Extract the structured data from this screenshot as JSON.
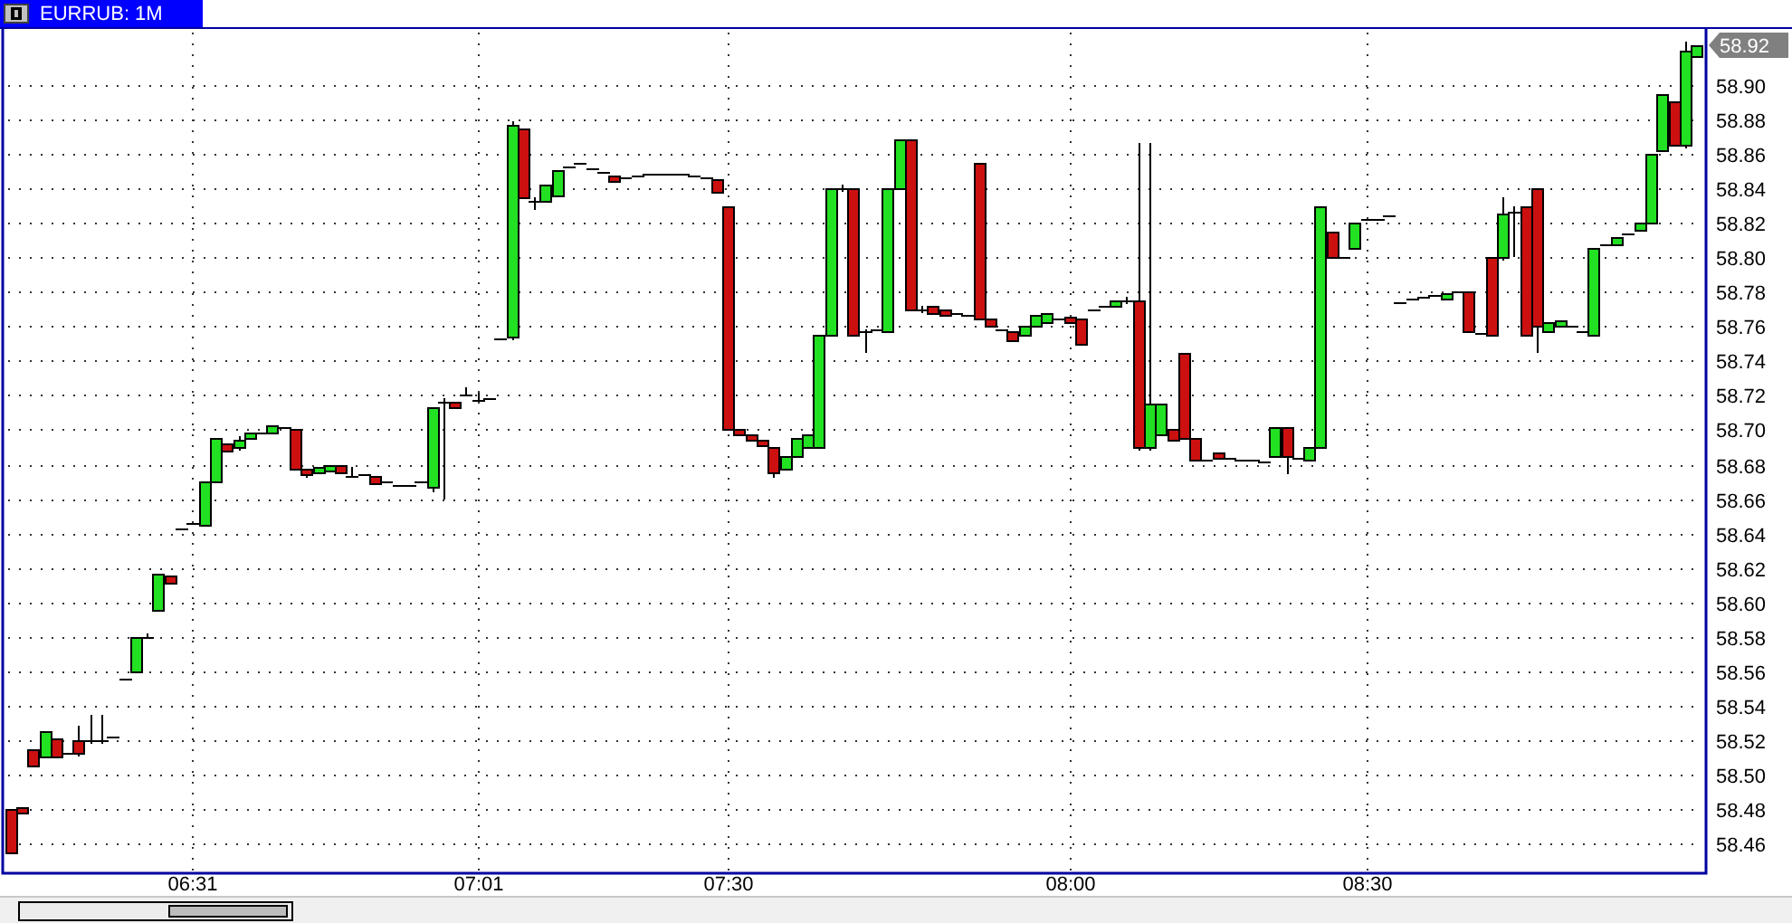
{
  "window": {
    "title": "EURRUB: 1M"
  },
  "chart_data": {
    "type": "candlestick",
    "categories": [
      null,
      null,
      null,
      null,
      null,
      null,
      null,
      null,
      null,
      null,
      null,
      null,
      null,
      null,
      null,
      null,
      "06:31",
      null,
      null,
      null,
      null,
      null,
      null,
      null,
      null,
      null,
      null,
      null,
      null,
      null,
      null,
      null,
      null,
      null,
      null,
      null,
      null,
      null,
      null,
      null,
      null,
      "07:01",
      null,
      null,
      null,
      null,
      null,
      null,
      null,
      null,
      null,
      null,
      null,
      null,
      null,
      null,
      null,
      null,
      null,
      null,
      null,
      null,
      null,
      "07:30",
      null,
      null,
      null,
      null,
      null,
      null,
      null,
      null,
      null,
      null,
      null,
      null,
      null,
      null,
      null,
      null,
      null,
      null,
      null,
      null,
      null,
      null,
      null,
      null,
      null,
      null,
      null,
      null,
      null,
      "08:00",
      null,
      null,
      null,
      null,
      null,
      null,
      null,
      null,
      null,
      null,
      null,
      null,
      null,
      null,
      null,
      null,
      null,
      null,
      null,
      null,
      null,
      null,
      null,
      null,
      null,
      "08:30",
      null,
      null,
      null,
      null,
      null,
      null,
      null,
      null,
      null,
      null,
      null,
      null,
      null,
      null,
      null,
      null,
      null,
      null,
      null,
      null,
      null,
      null,
      null,
      null,
      null,
      null,
      null,
      null,
      null
    ],
    "ohlc": [
      [
        58.48,
        58.48,
        58.455,
        58.455
      ],
      [
        58.481,
        58.481,
        58.479,
        58.479
      ],
      [
        58.515,
        58.515,
        58.505,
        58.505
      ],
      [
        58.51,
        58.525,
        58.51,
        58.525
      ],
      [
        58.521,
        58.521,
        58.511,
        58.511
      ],
      [
        58.513,
        58.513,
        58.513,
        58.513
      ],
      [
        58.52,
        58.528,
        58.511,
        58.513
      ],
      [
        58.52,
        58.535,
        58.518,
        58.52
      ],
      [
        58.52,
        58.535,
        58.518,
        58.52
      ],
      [
        58.522,
        58.522,
        58.522,
        58.522
      ],
      [
        58.556,
        58.556,
        58.556,
        58.556
      ],
      [
        58.56,
        58.58,
        58.56,
        58.58
      ],
      [
        58.58,
        58.582,
        58.579,
        58.58
      ],
      [
        58.595,
        58.617,
        58.595,
        58.617
      ],
      [
        58.615,
        58.615,
        58.611,
        58.611
      ],
      [
        58.643,
        58.643,
        58.643,
        58.643
      ],
      [
        58.646,
        58.646,
        58.646,
        58.646
      ],
      [
        58.645,
        58.67,
        58.645,
        58.67
      ],
      [
        58.67,
        58.695,
        58.67,
        58.695
      ],
      [
        58.692,
        58.692,
        58.688,
        58.688
      ],
      [
        58.69,
        58.696,
        58.688,
        58.694
      ],
      [
        58.695,
        58.698,
        58.695,
        58.698
      ],
      [
        58.698,
        58.698,
        58.698,
        58.698
      ],
      [
        58.698,
        58.703,
        58.698,
        58.703
      ],
      [
        58.702,
        58.702,
        58.702,
        58.702
      ],
      [
        58.7,
        58.7,
        58.677,
        58.677
      ],
      [
        58.677,
        58.677,
        58.672,
        58.674
      ],
      [
        58.675,
        58.678,
        58.675,
        58.678
      ],
      [
        58.677,
        58.68,
        58.677,
        58.68
      ],
      [
        58.68,
        58.68,
        58.675,
        58.675
      ],
      [
        58.673,
        58.678,
        58.672,
        58.673
      ],
      [
        58.674,
        58.674,
        58.674,
        58.674
      ],
      [
        58.673,
        58.673,
        58.669,
        58.669
      ],
      [
        58.67,
        58.67,
        58.67,
        58.67
      ],
      [
        58.668,
        58.668,
        58.668,
        58.668
      ],
      [
        58.668,
        58.668,
        58.668,
        58.668
      ],
      [
        58.67,
        58.67,
        58.67,
        58.67
      ],
      [
        58.667,
        58.713,
        58.664,
        58.713
      ],
      [
        58.716,
        58.718,
        58.66,
        58.716
      ],
      [
        58.716,
        58.716,
        58.713,
        58.713
      ],
      [
        58.72,
        58.725,
        58.719,
        58.72
      ],
      [
        58.717,
        58.721,
        58.716,
        58.717
      ],
      [
        58.718,
        58.718,
        58.718,
        58.718
      ],
      [
        58.753,
        58.753,
        58.753,
        58.753
      ],
      [
        58.754,
        58.879,
        58.752,
        58.877
      ],
      [
        58.875,
        58.875,
        58.835,
        58.835
      ],
      [
        58.833,
        58.835,
        58.828,
        58.833
      ],
      [
        58.833,
        58.842,
        58.833,
        58.842
      ],
      [
        58.836,
        58.851,
        58.836,
        58.851
      ],
      [
        58.853,
        58.853,
        58.853,
        58.853
      ],
      [
        58.855,
        58.855,
        58.855,
        58.855
      ],
      [
        58.852,
        58.852,
        58.852,
        58.852
      ],
      [
        58.85,
        58.85,
        58.85,
        58.85
      ],
      [
        58.847,
        58.847,
        58.844,
        58.844
      ],
      [
        58.846,
        58.846,
        58.846,
        58.846
      ],
      [
        58.847,
        58.847,
        58.847,
        58.847
      ],
      [
        58.848,
        58.848,
        58.848,
        58.848
      ],
      [
        58.849,
        58.849,
        58.849,
        58.849
      ],
      [
        58.849,
        58.849,
        58.849,
        58.849
      ],
      [
        58.848,
        58.848,
        58.848,
        58.848
      ],
      [
        58.847,
        58.847,
        58.847,
        58.847
      ],
      [
        58.846,
        58.846,
        58.846,
        58.846
      ],
      [
        58.845,
        58.845,
        58.838,
        58.838
      ],
      [
        58.83,
        58.83,
        58.7,
        58.7
      ],
      [
        58.7,
        58.7,
        58.697,
        58.697
      ],
      [
        58.697,
        58.697,
        58.695,
        58.695
      ],
      [
        58.694,
        58.694,
        58.691,
        58.691
      ],
      [
        58.69,
        58.69,
        58.672,
        58.675
      ],
      [
        58.677,
        58.685,
        58.677,
        58.685
      ],
      [
        58.685,
        58.695,
        58.685,
        58.695
      ],
      [
        58.69,
        58.697,
        58.69,
        58.697
      ],
      [
        58.69,
        58.755,
        58.69,
        58.755
      ],
      [
        58.755,
        58.84,
        58.755,
        58.84
      ],
      [
        58.84,
        58.842,
        58.838,
        58.84
      ],
      [
        58.84,
        58.84,
        58.755,
        58.755
      ],
      [
        58.757,
        58.758,
        58.745,
        58.757
      ],
      [
        58.758,
        58.758,
        58.758,
        58.758
      ],
      [
        58.757,
        58.84,
        58.757,
        58.84
      ],
      [
        58.84,
        58.868,
        58.84,
        58.868
      ],
      [
        58.868,
        58.868,
        58.77,
        58.77
      ],
      [
        58.77,
        58.772,
        58.768,
        58.77
      ],
      [
        58.772,
        58.772,
        58.768,
        58.768
      ],
      [
        58.77,
        58.77,
        58.767,
        58.767
      ],
      [
        58.768,
        58.768,
        58.768,
        58.768
      ],
      [
        58.767,
        58.767,
        58.767,
        58.767
      ],
      [
        58.855,
        58.855,
        58.765,
        58.765
      ],
      [
        58.765,
        58.765,
        58.76,
        58.76
      ],
      [
        58.758,
        58.758,
        58.758,
        58.758
      ],
      [
        58.757,
        58.757,
        58.752,
        58.752
      ],
      [
        58.755,
        58.76,
        58.755,
        58.76
      ],
      [
        58.76,
        58.767,
        58.76,
        58.767
      ],
      [
        58.762,
        58.768,
        58.762,
        58.768
      ],
      [
        58.765,
        58.765,
        58.765,
        58.765
      ],
      [
        58.766,
        58.766,
        58.764,
        58.764
      ],
      [
        58.765,
        58.765,
        58.75,
        58.75
      ],
      [
        58.77,
        58.77,
        58.77,
        58.77
      ],
      [
        58.772,
        58.772,
        58.772,
        58.772
      ],
      [
        58.772,
        58.775,
        58.772,
        58.775
      ],
      [
        58.775,
        58.777,
        58.773,
        58.775
      ],
      [
        58.775,
        58.866,
        58.688,
        58.69
      ],
      [
        58.69,
        58.866,
        58.688,
        58.715
      ],
      [
        58.697,
        58.715,
        58.697,
        58.715
      ],
      [
        58.7,
        58.7,
        58.694,
        58.694
      ],
      [
        58.745,
        58.745,
        58.695,
        58.695
      ],
      [
        58.695,
        58.695,
        58.683,
        58.683
      ],
      [
        58.683,
        58.683,
        58.683,
        58.683
      ],
      [
        58.687,
        58.687,
        58.685,
        58.685
      ],
      [
        58.684,
        58.684,
        58.684,
        58.684
      ],
      [
        58.683,
        58.683,
        58.683,
        58.683
      ],
      [
        58.683,
        58.683,
        58.683,
        58.683
      ],
      [
        58.682,
        58.682,
        58.682,
        58.682
      ],
      [
        58.685,
        58.702,
        58.685,
        58.702
      ],
      [
        58.702,
        58.702,
        58.674,
        58.685
      ],
      [
        58.684,
        58.684,
        58.684,
        58.684
      ],
      [
        58.683,
        58.69,
        58.683,
        58.69
      ],
      [
        58.69,
        58.83,
        58.69,
        58.83
      ],
      [
        58.815,
        58.815,
        58.8,
        58.8
      ],
      [
        58.8,
        58.8,
        58.8,
        58.8
      ],
      [
        58.805,
        58.82,
        58.805,
        58.82
      ],
      [
        58.822,
        58.822,
        58.822,
        58.822
      ],
      [
        58.822,
        58.822,
        58.822,
        58.822
      ],
      [
        58.824,
        58.824,
        58.824,
        58.824
      ],
      [
        58.774,
        58.774,
        58.774,
        58.774
      ],
      [
        58.776,
        58.776,
        58.776,
        58.776
      ],
      [
        58.777,
        58.777,
        58.777,
        58.777
      ],
      [
        58.778,
        58.778,
        58.778,
        58.778
      ],
      [
        58.777,
        58.779,
        58.777,
        58.779
      ],
      [
        58.78,
        58.78,
        58.78,
        58.78
      ],
      [
        58.78,
        58.78,
        58.757,
        58.757
      ],
      [
        58.756,
        58.756,
        58.756,
        58.756
      ],
      [
        58.8,
        58.8,
        58.755,
        58.755
      ],
      [
        58.8,
        58.835,
        58.798,
        58.825
      ],
      [
        58.826,
        58.83,
        58.8,
        58.826
      ],
      [
        58.83,
        58.83,
        58.755,
        58.755
      ],
      [
        58.84,
        58.84,
        58.745,
        58.76
      ],
      [
        58.757,
        58.762,
        58.757,
        58.762
      ],
      [
        58.76,
        58.763,
        58.76,
        58.763
      ],
      [
        58.76,
        58.76,
        58.76,
        58.76
      ],
      [
        58.757,
        58.757,
        58.757,
        58.757
      ],
      [
        58.755,
        58.806,
        58.755,
        58.806
      ],
      [
        58.808,
        58.808,
        58.808,
        58.808
      ],
      [
        58.808,
        58.812,
        58.808,
        58.812
      ],
      [
        58.814,
        58.814,
        58.814,
        58.814
      ],
      [
        58.816,
        58.82,
        58.816,
        58.82
      ],
      [
        58.82,
        58.86,
        58.82,
        58.86
      ],
      [
        58.862,
        58.895,
        58.862,
        58.895
      ],
      [
        58.89,
        58.89,
        58.865,
        58.865
      ],
      [
        58.865,
        58.925,
        58.863,
        58.92
      ],
      [
        58.917,
        58.923,
        58.917,
        58.923
      ]
    ],
    "grid": true,
    "ylim": [
      58.4433,
      58.9325
    ],
    "yticks": [
      {
        "value": 58.46,
        "label": "58.46"
      },
      {
        "value": 58.48,
        "label": "58.48"
      },
      {
        "value": 58.5,
        "label": "58.50"
      },
      {
        "value": 58.52,
        "label": "58.52"
      },
      {
        "value": 58.54,
        "label": "58.54"
      },
      {
        "value": 58.56,
        "label": "58.56"
      },
      {
        "value": 58.58,
        "label": "58.58"
      },
      {
        "value": 58.6,
        "label": "58.60"
      },
      {
        "value": 58.62,
        "label": "58.62"
      },
      {
        "value": 58.64,
        "label": "58.64"
      },
      {
        "value": 58.66,
        "label": "58.66"
      },
      {
        "value": 58.68,
        "label": "58.68"
      },
      {
        "value": 58.7,
        "label": "58.70"
      },
      {
        "value": 58.72,
        "label": "58.72"
      },
      {
        "value": 58.74,
        "label": "58.74"
      },
      {
        "value": 58.76,
        "label": "58.76"
      },
      {
        "value": 58.78,
        "label": "58.78"
      },
      {
        "value": 58.8,
        "label": "58.80"
      },
      {
        "value": 58.82,
        "label": "58.82"
      },
      {
        "value": 58.84,
        "label": "58.84"
      },
      {
        "value": 58.86,
        "label": "58.86"
      },
      {
        "value": 58.88,
        "label": "58.88"
      },
      {
        "value": 58.9,
        "label": "58.90"
      }
    ]
  },
  "price_axis": {
    "current_price": "58.92"
  }
}
